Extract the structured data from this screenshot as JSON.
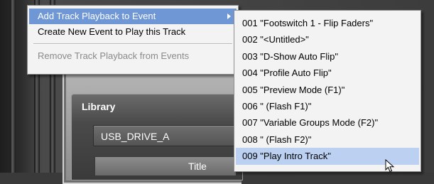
{
  "library": {
    "title": "Library",
    "drive": "USB_DRIVE_A",
    "column_title": "Title"
  },
  "context_menu": {
    "items": [
      {
        "label": "Add Track Playback to Event",
        "has_submenu": true,
        "highlighted": true
      },
      {
        "label": "Create New Event to Play this Track"
      },
      {
        "label": "Remove Track Playback from Events",
        "disabled": true
      }
    ]
  },
  "submenu": {
    "items": [
      {
        "label": "001 \"Footswitch 1 - Flip Faders\""
      },
      {
        "label": "002 \"<Untitled>\""
      },
      {
        "label": "003 \"D-Show Auto Flip\""
      },
      {
        "label": "004 \"Profile Auto Flip\""
      },
      {
        "label": "005 \"Preview Mode (F1)\""
      },
      {
        "label": "006 \"  (Flash F1)\""
      },
      {
        "label": "007 \"Variable Groups Mode (F2)\""
      },
      {
        "label": "008 \"  (Flash F2)\""
      },
      {
        "label": "009 \"Play Intro Track\"",
        "hovered": true
      }
    ]
  },
  "colors": {
    "highlight": "#6f97d6",
    "hover": "#bcd1f2",
    "menu_bg": "#f3f3f3"
  }
}
